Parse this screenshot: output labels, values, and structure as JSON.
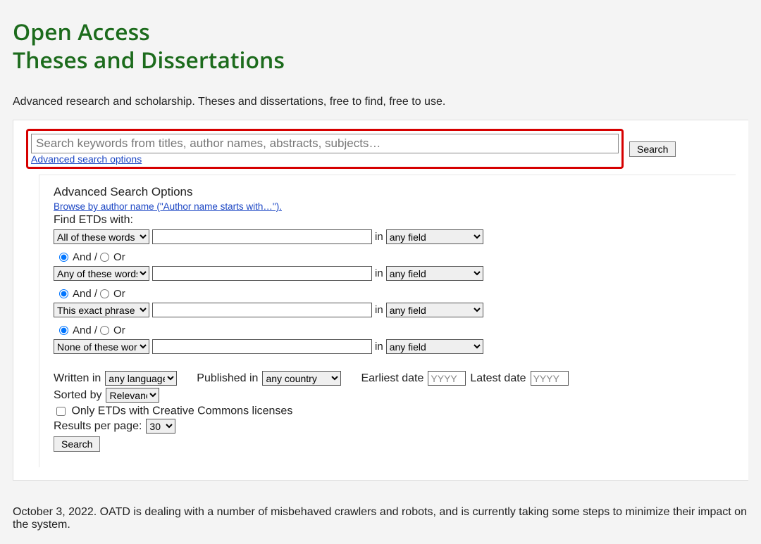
{
  "title_line1": "Open Access",
  "title_line2": "Theses and Dissertations",
  "tagline": "Advanced research and scholarship. Theses and dissertations, free to find, free to use.",
  "search": {
    "placeholder": "Search keywords from titles, author names, abstracts, subjects…",
    "button": "Search",
    "advanced_link": "Advanced search options"
  },
  "adv": {
    "heading": "Advanced Search Options",
    "browse": "Browse by author name (\"Author name starts with…\").",
    "find_label": "Find ETDs with:",
    "in_label": "in",
    "rows": [
      {
        "mode": "All of these words",
        "field": "any field"
      },
      {
        "mode": "Any of these words",
        "field": "any field"
      },
      {
        "mode": "This exact phrase",
        "field": "any field"
      },
      {
        "mode": "None of these words",
        "field": "any field"
      }
    ],
    "bool": {
      "and": "And / ",
      "or": "Or"
    },
    "written_in": "Written in",
    "language": "any language",
    "published_in": "Published in",
    "country": "any country",
    "earliest": "Earliest date",
    "latest": "Latest date",
    "year_ph": "YYYY",
    "sorted_by": "Sorted by",
    "sort": "Relevance",
    "cc_label": "Only ETDs with Creative Commons licenses",
    "rpp_label": "Results per page:",
    "rpp": "30",
    "submit": "Search"
  },
  "footer": "October 3, 2022. OATD is dealing with a number of misbehaved crawlers and robots, and is currently taking some steps to minimize their impact on the system."
}
